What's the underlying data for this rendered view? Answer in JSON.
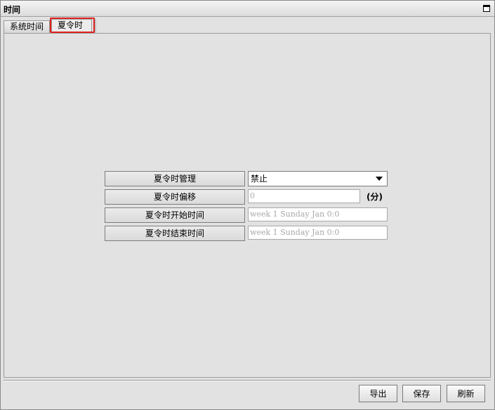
{
  "window": {
    "title": "时间"
  },
  "tabs": [
    {
      "label": "系统时间"
    },
    {
      "label": "夏令时"
    }
  ],
  "form": {
    "dst_management": {
      "label": "夏令时管理",
      "value": "禁止"
    },
    "dst_offset": {
      "label": "夏令时偏移",
      "placeholder": "0",
      "unit": "(分)"
    },
    "dst_start": {
      "label": "夏令时开始时间",
      "placeholder": "week 1 Sunday Jan 0:0"
    },
    "dst_end": {
      "label": "夏令时结束时间",
      "placeholder": "week 1 Sunday Jan 0:0"
    }
  },
  "buttons": {
    "export": "导出",
    "save": "保存",
    "refresh": "刷新"
  },
  "colors": {
    "highlight": "#e02020",
    "background": "#e2e2e2"
  }
}
